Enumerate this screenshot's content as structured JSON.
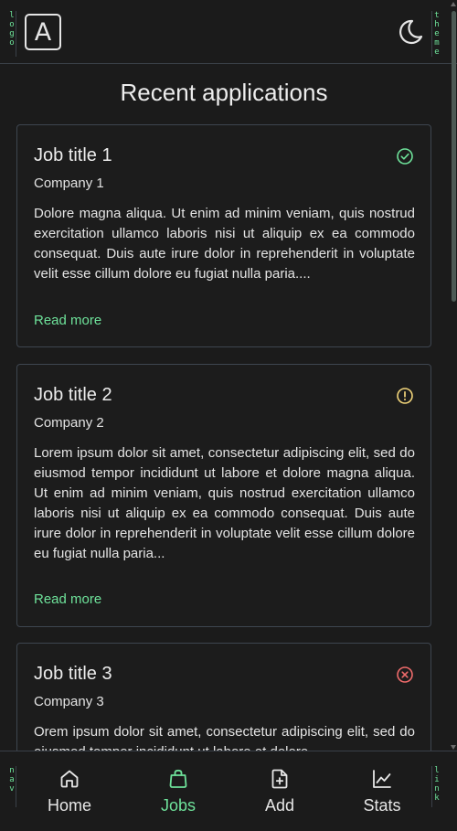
{
  "header": {
    "logo_tag": "logo",
    "logo_letter": "A",
    "theme_tag": "theme",
    "theme_icon": "moon-icon"
  },
  "page": {
    "title": "Recent applications"
  },
  "jobs": [
    {
      "title": "Job title 1",
      "company": "Company 1",
      "description": "Dolore magna aliqua. Ut enim ad minim veniam, quis nostrud exercitation ullamco laboris nisi ut aliquip ex ea commodo consequat. Duis aute irure dolor in reprehenderit in voluptate velit esse cillum dolore eu fugiat nulla paria....",
      "read_more": "Read more",
      "status_icon": "check-circle-icon",
      "status_color": "#6ee29a"
    },
    {
      "title": "Job title 2",
      "company": "Company 2",
      "description": "Lorem ipsum dolor sit amet, consectetur adipiscing elit, sed do eiusmod tempor incididunt ut labore et dolore magna aliqua. Ut enim ad minim veniam, quis nostrud exercitation ullamco laboris nisi ut aliquip ex ea commodo consequat. Duis aute irure dolor in reprehenderit in voluptate velit esse cillum dolore eu fugiat nulla paria...",
      "read_more": "Read more",
      "status_icon": "alert-circle-icon",
      "status_color": "#f2d57a"
    },
    {
      "title": "Job title 3",
      "company": "Company 3",
      "description": "Orem ipsum dolor sit amet, consectetur adipiscing elit, sed do eiusmod tempor incididunt ut labore et dolore",
      "status_icon": "x-circle-icon",
      "status_color": "#ef6b6b"
    }
  ],
  "nav": {
    "left_tag": "nav",
    "right_tag": "link",
    "items": [
      {
        "label": "Home",
        "icon": "home-icon"
      },
      {
        "label": "Jobs",
        "icon": "bag-icon",
        "active": true
      },
      {
        "label": "Add",
        "icon": "file-plus-icon"
      },
      {
        "label": "Stats",
        "icon": "chart-line-icon"
      }
    ]
  },
  "colors": {
    "background": "#1b1b1b",
    "accent": "#6ee29a",
    "border": "#3e4650"
  }
}
